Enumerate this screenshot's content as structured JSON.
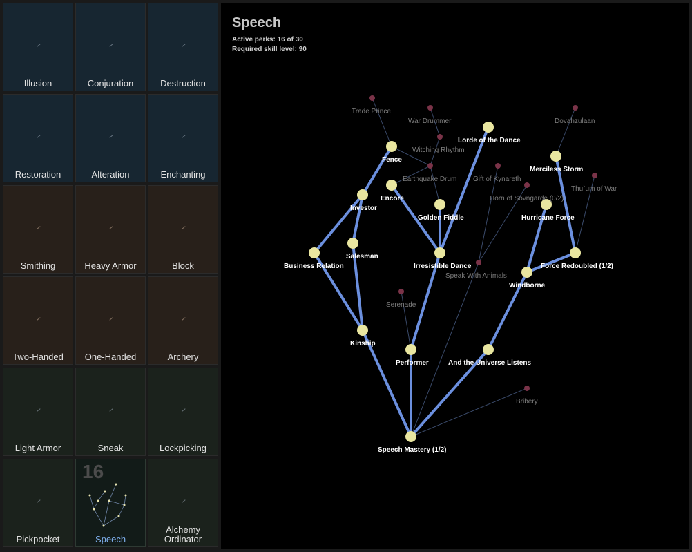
{
  "skills": [
    {
      "label": "Illusion",
      "group": "magic"
    },
    {
      "label": "Conjuration",
      "group": "magic"
    },
    {
      "label": "Destruction",
      "group": "magic"
    },
    {
      "label": "Restoration",
      "group": "magic"
    },
    {
      "label": "Alteration",
      "group": "magic"
    },
    {
      "label": "Enchanting",
      "group": "magic"
    },
    {
      "label": "Smithing",
      "group": "warrior"
    },
    {
      "label": "Heavy Armor",
      "group": "warrior"
    },
    {
      "label": "Block",
      "group": "warrior"
    },
    {
      "label": "Two-Handed",
      "group": "warrior"
    },
    {
      "label": "One-Handed",
      "group": "warrior"
    },
    {
      "label": "Archery",
      "group": "warrior"
    },
    {
      "label": "Light Armor",
      "group": "thief"
    },
    {
      "label": "Sneak",
      "group": "thief"
    },
    {
      "label": "Lockpicking",
      "group": "thief"
    },
    {
      "label": "Pickpocket",
      "group": "thief"
    },
    {
      "label": "Speech",
      "group": "thief",
      "selected": true,
      "count": "16"
    },
    {
      "label": "Alchemy Ordinator",
      "group": "thief"
    }
  ],
  "tree": {
    "title": "Speech",
    "active_perks": "Active perks: 16 of 30",
    "required_level": "Required skill level: 90",
    "colors": {
      "active_node": "#e9e6a0",
      "active_edge": "#6b8fde",
      "inactive_node": "#7a3348",
      "inactive_edge": "#3a4a6a"
    },
    "perks": [
      {
        "id": "speech_mastery",
        "label": "Speech Mastery (1/2)",
        "active": true
      },
      {
        "id": "kinship",
        "label": "Kinship",
        "active": true
      },
      {
        "id": "performer",
        "label": "Performer",
        "active": true
      },
      {
        "id": "universe",
        "label": "And the Universe Listens",
        "active": true
      },
      {
        "id": "business",
        "label": "Business Relation",
        "active": true
      },
      {
        "id": "salesman",
        "label": "Salesman",
        "active": true
      },
      {
        "id": "investor",
        "label": "Investor",
        "active": true
      },
      {
        "id": "fence",
        "label": "Fence",
        "active": true
      },
      {
        "id": "irresistible",
        "label": "Irresistible Dance",
        "active": true
      },
      {
        "id": "golden",
        "label": "Golden Fiddle",
        "active": true
      },
      {
        "id": "encore",
        "label": "Encore",
        "active": true
      },
      {
        "id": "lorde",
        "label": "Lorde of the Dance",
        "active": true
      },
      {
        "id": "windborne",
        "label": "Windborne",
        "active": true
      },
      {
        "id": "force",
        "label": "Force Redoubled (1/2)",
        "active": true
      },
      {
        "id": "hurricane",
        "label": "Hurricane Force",
        "active": true
      },
      {
        "id": "merciless",
        "label": "Merciless Storm",
        "active": true
      },
      {
        "id": "trade_prince",
        "label": "Trade Prince",
        "active": false
      },
      {
        "id": "war_drummer",
        "label": "War Drummer",
        "active": false
      },
      {
        "id": "witching",
        "label": "Witching Rhythm",
        "active": false
      },
      {
        "id": "earthquake",
        "label": "Earthquake Drum",
        "active": false
      },
      {
        "id": "kynareth",
        "label": "Gift of Kynareth",
        "active": false
      },
      {
        "id": "sovngarde",
        "label": "Horn of Sovngarde (0/2)",
        "active": false
      },
      {
        "id": "dovahzulaan",
        "label": "Dovahzulaan",
        "active": false
      },
      {
        "id": "thuum",
        "label": "Thu`um of War",
        "active": false
      },
      {
        "id": "serenade",
        "label": "Serenade",
        "active": false
      },
      {
        "id": "animals",
        "label": "Speak With Animals",
        "active": false
      },
      {
        "id": "bribery",
        "label": "Bribery",
        "active": false
      }
    ],
    "edges": [
      [
        "speech_mastery",
        "kinship",
        true
      ],
      [
        "speech_mastery",
        "performer",
        true
      ],
      [
        "speech_mastery",
        "universe",
        true
      ],
      [
        "kinship",
        "business",
        true
      ],
      [
        "kinship",
        "salesman",
        true
      ],
      [
        "business",
        "investor",
        true
      ],
      [
        "salesman",
        "investor",
        true
      ],
      [
        "investor",
        "fence",
        true
      ],
      [
        "performer",
        "irresistible",
        true
      ],
      [
        "irresistible",
        "golden",
        true
      ],
      [
        "irresistible",
        "encore",
        true
      ],
      [
        "irresistible",
        "lorde",
        true
      ],
      [
        "universe",
        "windborne",
        true
      ],
      [
        "windborne",
        "hurricane",
        true
      ],
      [
        "windborne",
        "force",
        true
      ],
      [
        "force",
        "merciless",
        true
      ],
      [
        "fence",
        "trade_prince",
        false
      ],
      [
        "fence",
        "earthquake",
        false
      ],
      [
        "encore",
        "earthquake",
        false
      ],
      [
        "golden",
        "earthquake",
        false
      ],
      [
        "earthquake",
        "witching",
        false
      ],
      [
        "witching",
        "war_drummer",
        false
      ],
      [
        "speech_mastery",
        "animals",
        false
      ],
      [
        "animals",
        "kynareth",
        false
      ],
      [
        "animals",
        "sovngarde",
        false
      ],
      [
        "merciless",
        "dovahzulaan",
        false
      ],
      [
        "force",
        "thuum",
        false
      ],
      [
        "performer",
        "serenade",
        false
      ],
      [
        "speech_mastery",
        "bribery",
        false
      ]
    ]
  }
}
